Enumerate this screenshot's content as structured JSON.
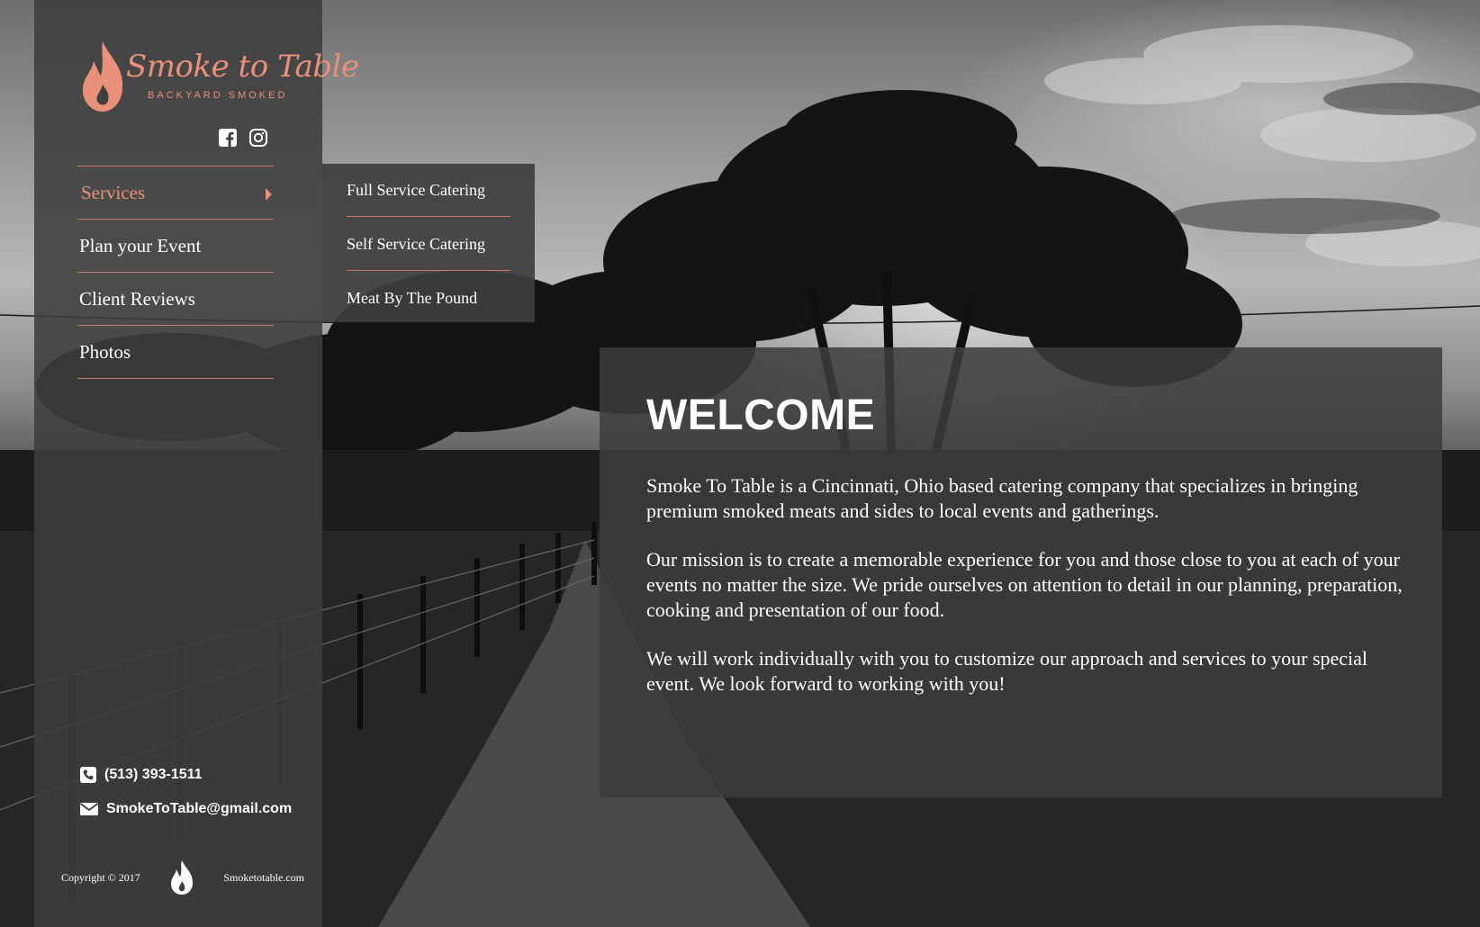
{
  "brand": {
    "name": "Smoke to Table",
    "tagline": "BACKYARD SMOKED",
    "accent_color": "#e9907a"
  },
  "social": [
    {
      "icon": "facebook-icon"
    },
    {
      "icon": "instagram-icon"
    }
  ],
  "nav": {
    "items": [
      {
        "label": "Services",
        "active": true,
        "has_submenu": true
      },
      {
        "label": "Plan your Event"
      },
      {
        "label": "Client Reviews"
      },
      {
        "label": "Photos"
      }
    ]
  },
  "submenu": {
    "items": [
      {
        "label": "Full Service Catering"
      },
      {
        "label": "Self Service Catering"
      },
      {
        "label": "Meat By The Pound"
      }
    ]
  },
  "contact": {
    "phone": "(513) 393-1511",
    "email": "SmokeToTable@gmail.com"
  },
  "footer": {
    "copyright": "Copyright © 2017",
    "site": "Smoketotable.com"
  },
  "welcome": {
    "heading": "WELCOME",
    "paragraphs": [
      "Smoke To Table is a Cincinnati, Ohio based catering company that specializes in bringing premium smoked meats and sides to local events and gatherings.",
      "Our mission is to create a memorable experience for you and those close to you at each of your events no matter the size. We pride ourselves on attention to detail in our planning, preparation, cooking and presentation of our food.",
      "We will work individually with you to customize our approach and services to your special event. We look forward to working with you!"
    ]
  }
}
